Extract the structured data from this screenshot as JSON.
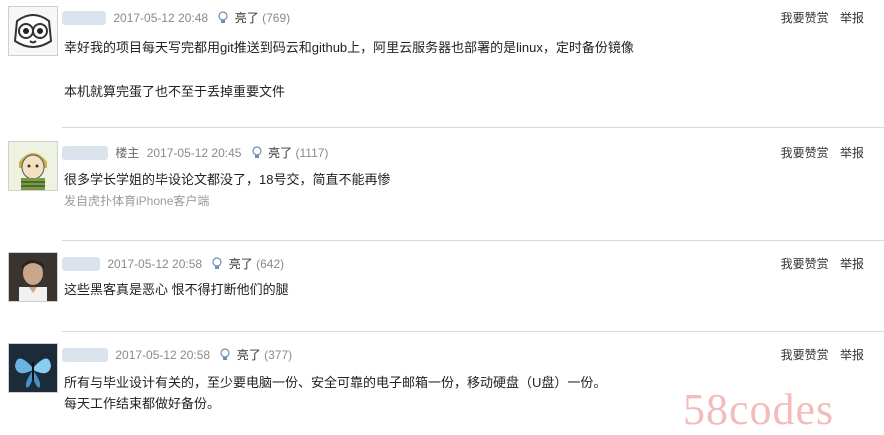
{
  "actions": {
    "reward_label": "我要赞赏",
    "report_label": "举报"
  },
  "like_label": "亮了",
  "comments": [
    {
      "badge": "",
      "time": "2017-05-12 20:48",
      "likes": "(769)",
      "lines": [
        "幸好我的项目每天写完都用git推送到码云和github上，阿里云服务器也部署的是linux，定时备份镜像",
        "本机就算完蛋了也不至于丢掉重要文件"
      ],
      "source": ""
    },
    {
      "badge": "楼主",
      "time": "2017-05-12 20:45",
      "likes": "(1117)",
      "lines": [
        "很多学长学姐的毕设论文都没了，18号交，简直不能再惨"
      ],
      "source": "发自虎扑体育iPhone客户端"
    },
    {
      "badge": "",
      "time": "2017-05-12 20:58",
      "likes": "(642)",
      "lines": [
        "这些黑客真是恶心 恨不得打断他们的腿"
      ],
      "source": ""
    },
    {
      "badge": "",
      "time": "2017-05-12 20:58",
      "likes": "(377)",
      "lines": [
        "所有与毕业设计有关的，至少要电脑一份、安全可靠的电子邮箱一份，移动硬盘（U盘）一份。",
        "每天工作结束都做好备份。"
      ],
      "source": ""
    }
  ],
  "watermark": "58codes"
}
